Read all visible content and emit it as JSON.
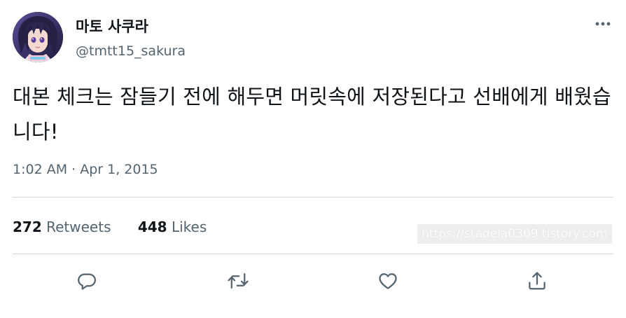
{
  "author": {
    "display_name": "마토 사쿠라",
    "handle": "@tmtt15_sakura"
  },
  "tweet": {
    "text": "대본 체크는 잠들기 전에 해두면 머릿속에 저장된다고 선배에게 배웠습니다!",
    "timestamp": "1:02 AM · Apr 1, 2015"
  },
  "stats": {
    "retweets_count": "272",
    "retweets_label": "Retweets",
    "likes_count": "448",
    "likes_label": "Likes"
  },
  "watermark": "https://stadela0309.tistory.com",
  "icons": {
    "more": "more-horizontal-icon",
    "reply": "reply-icon",
    "retweet": "retweet-icon",
    "like": "heart-icon",
    "share": "share-icon"
  },
  "colors": {
    "text_primary": "#0f1419",
    "text_secondary": "#536471",
    "divider": "#cfd9de"
  }
}
